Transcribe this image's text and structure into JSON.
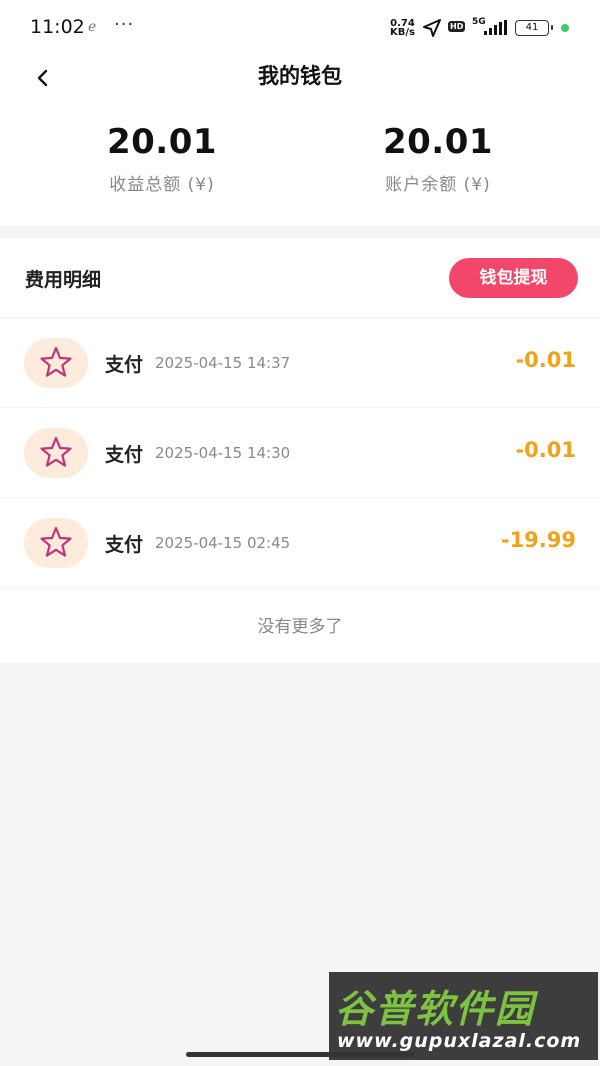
{
  "status_bar": {
    "time": "11:02",
    "dots": "···",
    "net_speed_value": "0.74",
    "net_speed_unit": "KB/s",
    "hd": "HD",
    "network": "5G",
    "battery": "41"
  },
  "header": {
    "title": "我的钱包"
  },
  "summary": {
    "income_total": "20.01",
    "income_label": "收益总额 (¥)",
    "balance": "20.01",
    "balance_label": "账户余额 (¥)"
  },
  "list": {
    "title": "费用明细",
    "withdraw_label": "钱包提现",
    "items": [
      {
        "type": "支付",
        "time": "2025-04-15 14:37",
        "amount": "-0.01"
      },
      {
        "type": "支付",
        "time": "2025-04-15 14:30",
        "amount": "-0.01"
      },
      {
        "type": "支付",
        "time": "2025-04-15 02:45",
        "amount": "-19.99"
      }
    ],
    "end_text": "没有更多了"
  },
  "watermark": {
    "brand": "谷普软件园",
    "url": "www.gupuxlazal.com"
  },
  "colors": {
    "accent": "#f2476b",
    "amount": "#f0a21a",
    "icon_bg": "#fdecdc",
    "star": "#c2337a"
  }
}
